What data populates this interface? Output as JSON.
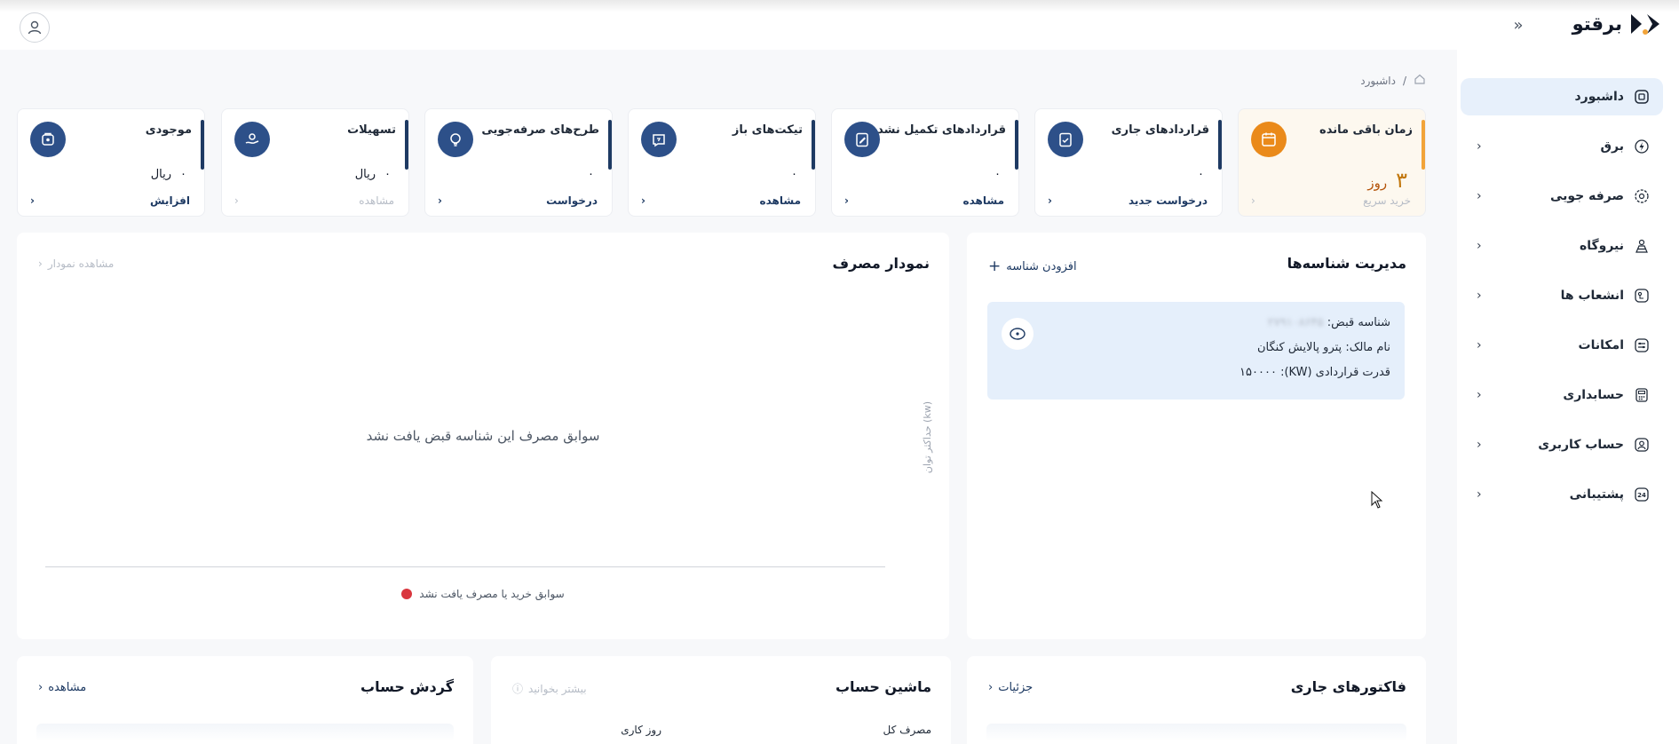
{
  "app": {
    "logo_text": "برقتو",
    "collapse_icon": "double-chevron-icon",
    "user_icon": "user-icon"
  },
  "sidebar": {
    "items": [
      {
        "label": "داشبورد",
        "icon": "dashboard-icon",
        "active": true
      },
      {
        "label": "برق",
        "icon": "lightning-icon"
      },
      {
        "label": "صرفه جویی",
        "icon": "savings-icon"
      },
      {
        "label": "نیروگاه",
        "icon": "power-plant-icon"
      },
      {
        "label": "انشعاب ها",
        "icon": "branch-icon"
      },
      {
        "label": "امکانات",
        "icon": "features-icon"
      },
      {
        "label": "حسابداری",
        "icon": "calculator-icon"
      },
      {
        "label": "حساب کاربری",
        "icon": "account-icon"
      },
      {
        "label": "پشتیبانی",
        "icon": "support-24-icon"
      }
    ]
  },
  "breadcrumb": {
    "separator": "/",
    "current": "داشبورد"
  },
  "cards": [
    {
      "title": "زمان باقی مانده",
      "value": "۳",
      "unit": "روز",
      "link": "خرید سریع",
      "link_disabled": true,
      "icon": "calendar-icon"
    },
    {
      "title": "قراردادهای جاری",
      "value": "۰",
      "unit": "",
      "link": "درخواست جدید",
      "link_disabled": false,
      "icon": "clipboard-check-icon"
    },
    {
      "title": "قراردادهای تکمیل نشده",
      "value": "۰",
      "unit": "",
      "link": "مشاهده",
      "link_disabled": false,
      "icon": "edit-document-icon"
    },
    {
      "title": "تیکت‌های باز",
      "value": "۰",
      "unit": "",
      "link": "مشاهده",
      "link_disabled": false,
      "icon": "ticket-icon"
    },
    {
      "title": "طرح‌های صرفه‌جویی",
      "value": "۰",
      "unit": "",
      "link": "درخواست",
      "link_disabled": false,
      "icon": "bulb-icon"
    },
    {
      "title": "تسهیلات",
      "value": "۰",
      "unit": "ریال",
      "link": "مشاهده",
      "link_disabled": true,
      "icon": "hand-coin-icon"
    },
    {
      "title": "موجودی",
      "value": "۰",
      "unit": "ریال",
      "link": "افزایش",
      "link_disabled": false,
      "icon": "wallet-icon"
    }
  ],
  "ids_panel": {
    "title": "مدیریت شناسه‌ها",
    "add_label": "افزودن شناسه",
    "bill_id_label": "شناسه قبض:",
    "bill_id_value": "۲۷۹۱۰۸۶۴۵",
    "owner_label": "نام مالک:",
    "owner_value": "پترو پالایش کنگان",
    "capacity_label": "قدرت قراردادی (KW):",
    "capacity_value": "۱۵۰۰۰۰"
  },
  "chart_panel": {
    "title": "نمودار مصرف",
    "view_link": "مشاهده نمودار",
    "empty_message": "سوابق مصرف این شناسه قبض یافت نشد",
    "ylabel": "حداکثر توان (kw)",
    "legend": "سوابق خرید یا مصرف یافت نشد",
    "legend_color": "#d9363e"
  },
  "chart_data": {
    "type": "line",
    "title": "نمودار مصرف",
    "xlabel": "",
    "ylabel": "حداکثر توان (kw)",
    "series": [],
    "legend": [
      "سوابق خرید یا مصرف یافت نشد"
    ]
  },
  "bottom": {
    "invoices": {
      "title": "فاکتورهای جاری",
      "link": "جزئیات"
    },
    "calculator": {
      "title": "ماشین حساب",
      "link": "بیشتر بخوانید",
      "total": "مصرف کل",
      "workday": "روز کاری"
    },
    "turnover": {
      "title": "گردش حساب",
      "link": "مشاهده"
    }
  },
  "colors": {
    "accent": "#1e3a63",
    "warning": "#ea8a1a",
    "active_bg": "#e7f0fb"
  }
}
